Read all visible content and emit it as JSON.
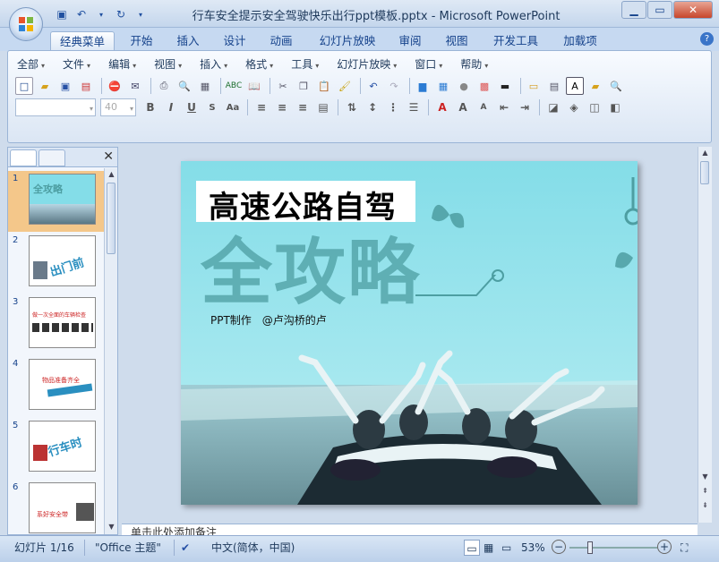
{
  "window": {
    "title": "行车安全提示安全驾驶快乐出行ppt模板.pptx - Microsoft PowerPoint"
  },
  "tabs": [
    "经典菜单",
    "开始",
    "插入",
    "设计",
    "动画",
    "幻灯片放映",
    "审阅",
    "视图",
    "开发工具",
    "加载项"
  ],
  "menus": [
    "全部",
    "文件",
    "编辑",
    "视图",
    "插入",
    "格式",
    "工具",
    "幻灯片放映",
    "窗口",
    "帮助"
  ],
  "font": {
    "name_placeholder": "",
    "size": "40"
  },
  "thumbnails": [
    {
      "num": "1",
      "text": "全攻略"
    },
    {
      "num": "2",
      "text": "出门前"
    },
    {
      "num": "3",
      "text": "做一次全面的车辆检查"
    },
    {
      "num": "4",
      "text": "物品准备齐全"
    },
    {
      "num": "5",
      "text": "行车时"
    },
    {
      "num": "6",
      "text": "系好安全带"
    }
  ],
  "slide": {
    "title": "高速公路自驾",
    "big": "全攻略",
    "subtitle": "PPT制作　@卢沟桥的卢"
  },
  "notes": {
    "placeholder": "单击此处添加备注"
  },
  "status": {
    "slide": "幻灯片 1/16",
    "theme": "\"Office 主题\"",
    "lang": "中文(简体，中国)",
    "zoom": "53%"
  },
  "colors": {
    "slide_bg": "#84dde8",
    "big_text": "#4d9ea2",
    "ribbon": "#dbe6f4",
    "selected_thumb": "#f4c78a"
  }
}
